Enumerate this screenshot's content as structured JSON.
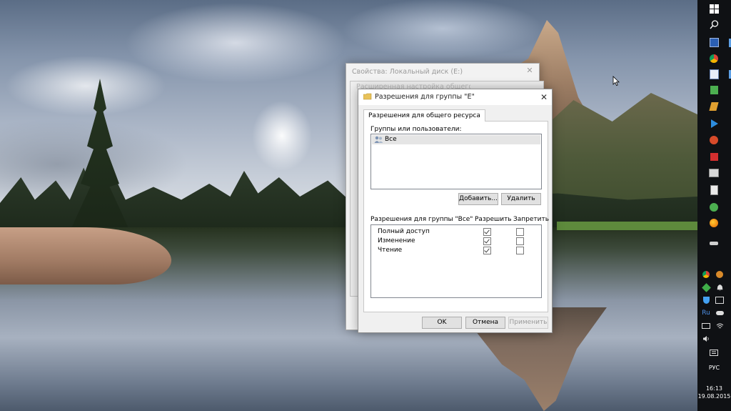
{
  "background_window": {
    "title": "Свойства: Локальный диск (E:)",
    "close_glyph": "✕"
  },
  "middle_window": {
    "title": "Расширенная настройка общего доступа"
  },
  "dialog": {
    "title": "Разрешения для группы \"E\"",
    "close_glyph": "✕",
    "tab_label": "Разрешения для общего ресурса",
    "groups_label": "Группы или пользователи:",
    "groups": [
      "Все"
    ],
    "add_button": "Добавить...",
    "remove_button": "Удалить",
    "permissions_label": "Разрешения для группы \"Все\"",
    "allow_header": "Разрешить",
    "deny_header": "Запретить",
    "permissions": [
      {
        "name": "Полный доступ",
        "allow": true,
        "deny": false
      },
      {
        "name": "Изменение",
        "allow": true,
        "deny": false
      },
      {
        "name": "Чтение",
        "allow": true,
        "deny": false
      }
    ],
    "ok_button": "OK",
    "cancel_button": "Отмена",
    "apply_button": "Применить"
  },
  "taskbar": {
    "start_icon": "windows-logo-icon",
    "search_icon": "search-icon",
    "language": "РУС",
    "time": "16:13",
    "date": "19.08.2015",
    "tray_lang": "Ru",
    "accent": "#5da0e6"
  }
}
